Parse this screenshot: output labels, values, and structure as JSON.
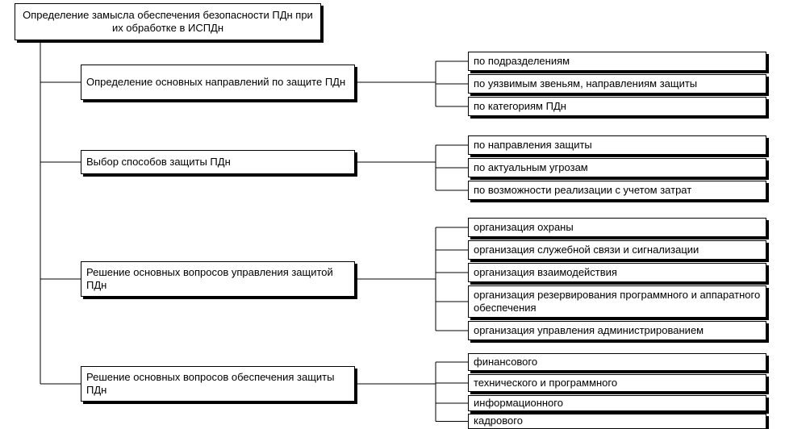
{
  "root": {
    "title": "Определение замысла обеспечения безопасности ПДн при их обработке в ИСПДн"
  },
  "branches": [
    {
      "label": "Определение основных направлений по защите ПДн",
      "items": [
        "по подразделениям",
        "по уязвимым звеньям, направлениям защиты",
        "по категориям ПДн"
      ]
    },
    {
      "label": "Выбор способов защиты ПДн",
      "items": [
        "по направления защиты",
        "по актуальным угрозам",
        "по возможности реализации с учетом затрат"
      ]
    },
    {
      "label": "Решение основных вопросов управления защитой ПДн",
      "items": [
        "организация охраны",
        "организация служебной связи и сигнализации",
        "организация взаимодействия",
        "организация резервирования программного и аппаратного обеспечения",
        "организация управления администрированием"
      ]
    },
    {
      "label": "Решение основных вопросов обеспечения защиты ПДн",
      "items": [
        "финансового",
        "технического и программного",
        "информационного",
        "кадрового"
      ]
    }
  ]
}
